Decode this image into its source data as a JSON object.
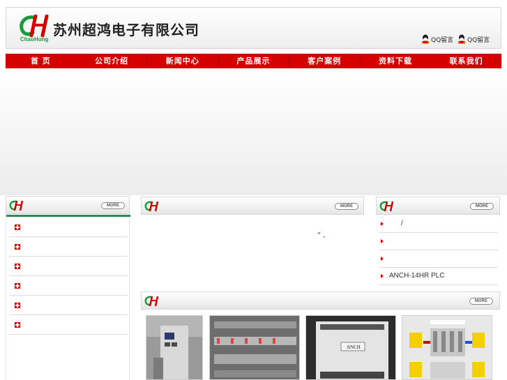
{
  "header": {
    "company_name": "苏州超鸿电子有限公司",
    "logo_text": "ChaoHong",
    "qq_links": [
      "QQ留言",
      "QQ留言"
    ]
  },
  "nav": {
    "items": [
      "首 页",
      "公司介绍",
      "新闻中心",
      "产品展示",
      "客户案例",
      "资料下载",
      "联系我们"
    ]
  },
  "panels": {
    "more_label": "MORE"
  },
  "middle": {
    "text": "“ ,"
  },
  "right_list": {
    "items": [
      "/",
      "",
      "",
      "ANCH-14HR PLC"
    ]
  },
  "colors": {
    "brand_red": "#d40000",
    "brand_green": "#2e8b57"
  }
}
